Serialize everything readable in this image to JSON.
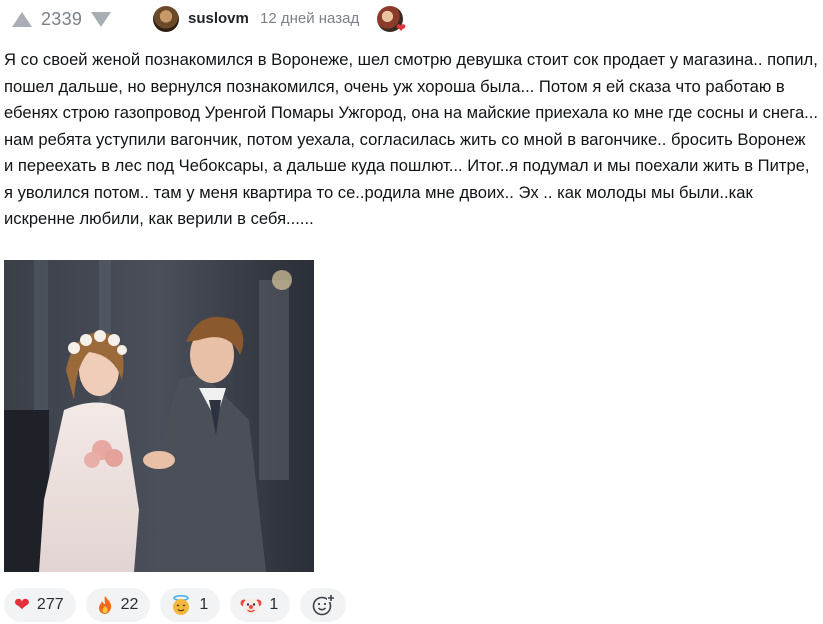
{
  "vote": {
    "rating": "2339",
    "upvote_icon": "arrow-up-icon",
    "downvote_icon": "arrow-down-icon"
  },
  "author": {
    "username": "suslovm",
    "timestamp": "12 дней назад"
  },
  "comment": {
    "text": "Я со своей женой познакомился в Воронеже, шел смотрю девушка стоит сок продает у магазина.. попил, пошел дальше, но вернулся познакомился, очень уж хороша была... Потом я ей сказа что работаю в ебенях строю газопровод Уренгой Помары Ужгород, она на майские приехала ко мне где сосны и снега... нам ребята уступили вагончик, потом уехала, согласилась жить со мной в вагончике.. бросить Воронеж и переехать в лес под Чебоксары, а дальше куда пошлют... Итог..я подумал и мы поехали жить в Питре, я уволился потом.. там у меня квартира то се..родила мне двоих.. Эх .. как молоды мы были..как искренне любили, как верили в себя......"
  },
  "reactions": [
    {
      "icon": "heart-icon",
      "emoji": "❤",
      "color": "#e3323e",
      "count": "277"
    },
    {
      "icon": "fire-icon",
      "emoji": "🔥",
      "color": "#f26b1d",
      "count": "22"
    },
    {
      "icon": "angel-face-icon",
      "emoji": "😇",
      "color": "#f5b73b",
      "count": "1"
    },
    {
      "icon": "clown-face-icon",
      "emoji": "🤡",
      "color": "#e84a4a",
      "count": "1"
    }
  ],
  "add_reaction": {
    "icon": "add-emoji-icon"
  }
}
